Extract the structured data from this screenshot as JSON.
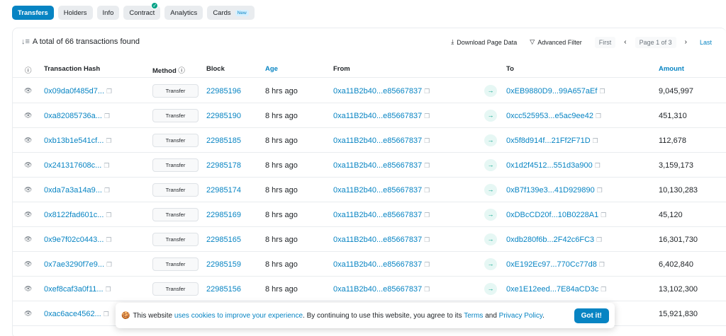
{
  "tabs": [
    {
      "label": "Transfers"
    },
    {
      "label": "Holders"
    },
    {
      "label": "Info"
    },
    {
      "label": "Contract"
    },
    {
      "label": "Analytics"
    },
    {
      "label": "Cards",
      "badge": "New"
    }
  ],
  "summary": "A total of 66 transactions found",
  "actions": {
    "download": "Download Page Data",
    "filter": "Advanced Filter",
    "first": "First",
    "page_info": "Page 1 of 3",
    "last": "Last"
  },
  "columns": {
    "hash": "Transaction Hash",
    "method": "Method",
    "block": "Block",
    "age": "Age",
    "from": "From",
    "to": "To",
    "amount": "Amount"
  },
  "rows": [
    {
      "hash": "0x09da0f485d7...",
      "method": "Transfer",
      "block": "22985196",
      "age": "8 hrs ago",
      "from": "0xa11B2b40...e85667837",
      "to": "0xEB9880D9...99A657aEf",
      "amount": "9,045,997"
    },
    {
      "hash": "0xa82085736a...",
      "method": "Transfer",
      "block": "22985190",
      "age": "8 hrs ago",
      "from": "0xa11B2b40...e85667837",
      "to": "0xcc525953...e5ac9ee42",
      "amount": "451,310"
    },
    {
      "hash": "0xb13b1e541cf...",
      "method": "Transfer",
      "block": "22985185",
      "age": "8 hrs ago",
      "from": "0xa11B2b40...e85667837",
      "to": "0x5f8d914f...21Ff2F71D",
      "amount": "112,678"
    },
    {
      "hash": "0x241317608c...",
      "method": "Transfer",
      "block": "22985178",
      "age": "8 hrs ago",
      "from": "0xa11B2b40...e85667837",
      "to": "0x1d2f4512...551d3a900",
      "amount": "3,159,173"
    },
    {
      "hash": "0xda7a3a14a9...",
      "method": "Transfer",
      "block": "22985174",
      "age": "8 hrs ago",
      "from": "0xa11B2b40...e85667837",
      "to": "0xB7f139e3...41D929890",
      "amount": "10,130,283"
    },
    {
      "hash": "0x8122fad601c...",
      "method": "Transfer",
      "block": "22985169",
      "age": "8 hrs ago",
      "from": "0xa11B2b40...e85667837",
      "to": "0xDBcCD20f...10B0228A1",
      "amount": "45,120"
    },
    {
      "hash": "0x9e7f02c0443...",
      "method": "Transfer",
      "block": "22985165",
      "age": "8 hrs ago",
      "from": "0xa11B2b40...e85667837",
      "to": "0xdb280f6b...2F42c6FC3",
      "amount": "16,301,730"
    },
    {
      "hash": "0x7ae3290f7e9...",
      "method": "Transfer",
      "block": "22985159",
      "age": "8 hrs ago",
      "from": "0xa11B2b40...e85667837",
      "to": "0xE192Ec97...770Cc77d8",
      "amount": "6,402,840"
    },
    {
      "hash": "0xef8caf3a0f11...",
      "method": "Transfer",
      "block": "22985156",
      "age": "8 hrs ago",
      "from": "0xa11B2b40...e85667837",
      "to": "0xe1E12eed...7E84aCD3c",
      "amount": "13,102,300"
    },
    {
      "hash": "0xac6ace4562...",
      "method": "Transfer",
      "block": "",
      "age": "",
      "from": "",
      "to": "",
      "amount": "15,921,830"
    }
  ],
  "cookie": {
    "pre": "This website ",
    "link1": "uses cookies to improve your experience",
    "mid": ". By continuing to use this website, you agree to its ",
    "link2": "Terms",
    "and": " and ",
    "link3": "Privacy Policy",
    "end": ".",
    "button": "Got it!"
  },
  "colors": {
    "accent": "#0784c3",
    "success": "#00a186"
  }
}
